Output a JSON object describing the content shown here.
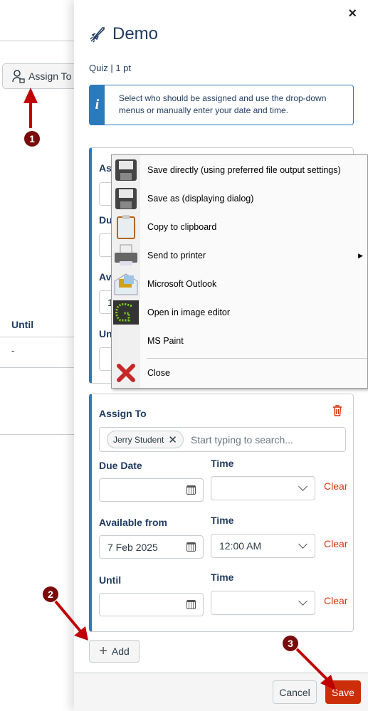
{
  "background": {
    "assign_to_button": "Assign To",
    "until_header": "Until",
    "until_value": "-"
  },
  "annotations": {
    "step1": "1",
    "step2": "2",
    "step3": "3",
    "arrow_color": "#c00000"
  },
  "panel": {
    "close": "×",
    "title": "Demo",
    "title_icon": "rocket-icon",
    "subtitle": "Quiz | 1 pt",
    "info_text": "Select who should be assigned and use the drop-down menus or manually enter your date and time.",
    "info_icon": "i",
    "card1": {
      "assign_to": "Assign To",
      "due_date": "Due Date",
      "available_from": "Available from",
      "available_value": "1",
      "until": "Until"
    },
    "card2": {
      "assign_to": "Assign To",
      "chip": "Jerry Student",
      "search_placeholder": "Start typing to search...",
      "due_date": "Due Date",
      "due_date_value": "",
      "due_time_label": "Time",
      "due_time_value": "",
      "available_from": "Available from",
      "available_value": "7 Feb 2025",
      "available_time_label": "Time",
      "available_time_value": "12:00 AM",
      "until": "Until",
      "until_value": "",
      "until_time_label": "Time",
      "until_time_value": "",
      "clear": "Clear"
    },
    "add": "Add",
    "cancel": "Cancel",
    "save": "Save"
  },
  "context_menu": {
    "items": [
      {
        "label": "Save directly (using preferred file output settings)",
        "icon": "floppy-disk-icon"
      },
      {
        "label": "Save as (displaying dialog)",
        "icon": "floppy-disk-icon"
      },
      {
        "label": "Copy to clipboard",
        "icon": "clipboard-icon"
      },
      {
        "label": "Send to printer",
        "icon": "printer-icon",
        "submenu": true
      },
      {
        "label": "Microsoft Outlook",
        "icon": "outlook-icon"
      },
      {
        "label": "Open in image editor",
        "icon": "greenshot-editor-icon"
      },
      {
        "label": "MS Paint",
        "icon": ""
      },
      {
        "label": "Close",
        "icon": "red-x-icon"
      }
    ]
  },
  "colors": {
    "accent": "#2b7abc",
    "navy": "#1f3a5f",
    "danger": "#d4340f",
    "save": "#cc2e0a"
  }
}
